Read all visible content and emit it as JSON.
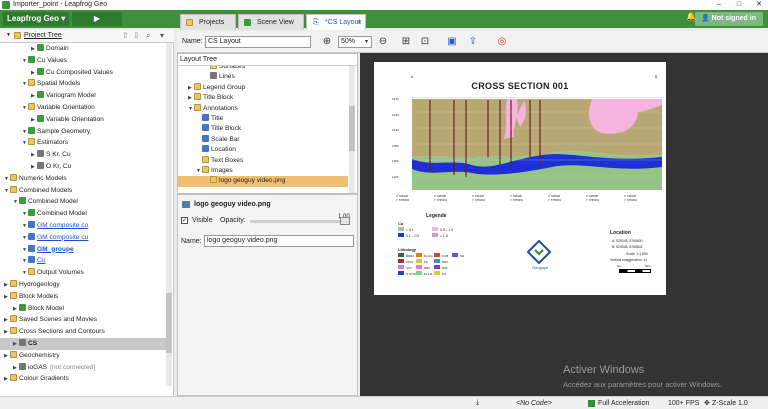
{
  "window": {
    "title": "Importer_point - Leapfrog Geo",
    "minimize": "–",
    "maximize": "□",
    "close": "✕"
  },
  "topbar": {
    "app_button": "Leapfrog Geo ▾",
    "play": "▶",
    "sign_in": "Not signed in",
    "bell_icon": "bell-icon"
  },
  "left_panel": {
    "title": "Project Tree",
    "rows": [
      {
        "label": "Domain",
        "indent": 3
      },
      {
        "label": "Cu Values",
        "indent": 2
      },
      {
        "label": "Cu Composited Values",
        "indent": 3
      },
      {
        "label": "Spatial Models",
        "indent": 2
      },
      {
        "label": "Variogram Model",
        "indent": 3
      },
      {
        "label": "Variable Orientation",
        "indent": 2
      },
      {
        "label": "Variable Orientation",
        "indent": 3
      },
      {
        "label": "Sample Geometry",
        "indent": 2
      },
      {
        "label": "Estimators",
        "indent": 2
      },
      {
        "label": "S Kr, Cu",
        "indent": 3
      },
      {
        "label": "O Kr, Cu",
        "indent": 3
      },
      {
        "label": "Numeric Models",
        "indent": 0
      },
      {
        "label": "Combined Models",
        "indent": 0
      },
      {
        "label": "Combined Model",
        "indent": 1
      },
      {
        "label": "Combined Model",
        "indent": 2
      },
      {
        "label": "GM composite co",
        "indent": 2
      },
      {
        "label": "GM composite cu",
        "indent": 2
      },
      {
        "label": "GM_groupe",
        "indent": 2
      },
      {
        "label": "Cu",
        "indent": 2
      },
      {
        "label": "Output Volumes",
        "indent": 2
      },
      {
        "label": "Hydrogeology",
        "indent": 0
      },
      {
        "label": "Block Models",
        "indent": 0
      },
      {
        "label": "Block Model",
        "indent": 1
      },
      {
        "label": "Saved Scenes and Movies",
        "indent": 0
      },
      {
        "label": "Cross Sections and Contours",
        "indent": 0
      },
      {
        "label": "CS",
        "indent": 1
      },
      {
        "label": "Geochemistry",
        "indent": 0
      },
      {
        "label": "ioGAS",
        "note": "[not connected]",
        "indent": 1
      },
      {
        "label": "Colour Gradients",
        "indent": 0
      }
    ]
  },
  "tabs": [
    {
      "label": "Projects"
    },
    {
      "label": "Scene View"
    },
    {
      "label": "*CS Layout"
    }
  ],
  "toolbar": {
    "name_label": "Name:",
    "name_value": "CS Layout",
    "zoom": "50%"
  },
  "layout_tree": {
    "title": "Layout Tree",
    "rows": [
      {
        "label": "Surfaces",
        "indent": 3
      },
      {
        "label": "Lines",
        "indent": 3
      },
      {
        "label": "Legend Group",
        "indent": 1
      },
      {
        "label": "Title Block",
        "indent": 1
      },
      {
        "label": "Annotations",
        "indent": 1
      },
      {
        "label": "Title",
        "indent": 2
      },
      {
        "label": "Title Block",
        "indent": 2
      },
      {
        "label": "Scale Bar",
        "indent": 2
      },
      {
        "label": "Location",
        "indent": 2
      },
      {
        "label": "Text Boxes",
        "indent": 2
      },
      {
        "label": "Images",
        "indent": 2
      },
      {
        "label": "logo geoguy video.png",
        "indent": 3
      }
    ]
  },
  "properties": {
    "title": "logo geoguy video.png",
    "visible_label": "Visible",
    "opacity_label": "Opacity:",
    "opacity_value": "1,00",
    "name_label": "Name:",
    "name_value": "logo geoguy video.png"
  },
  "section": {
    "title": "CROSS SECTION 001",
    "a": "A",
    "b": "B",
    "y_ticks": [
      "1270",
      "1240",
      "1210",
      "1180",
      "1150",
      "1120"
    ],
    "coords": [
      [
        "X: 525348",
        "Y: 8765600"
      ],
      [
        "X: 525398",
        "Y: 8765601"
      ],
      [
        "X: 525448",
        "Y: 8765601"
      ],
      [
        "X: 525498",
        "Y: 8765601"
      ],
      [
        "X: 525548",
        "Y: 8765601"
      ],
      [
        "X: 525598",
        "Y: 8765601"
      ],
      [
        "X: 525648",
        "Y: 8765601"
      ]
    ],
    "legend_title": "Legende",
    "cu_title": "Cu",
    "cu_items": [
      "< 0.1",
      "0.5 – 1.5",
      "0.1 – 0.5",
      "> 1.5"
    ],
    "litho_title": "Lithology",
    "litho_items": [
      "BDR2",
      "Dyoria",
      "CVB",
      "SD",
      "CMN",
      "FZ",
      "RSC",
      "",
      "CVT",
      "HBX",
      "RSF",
      "",
      "D STRAT",
      "M & R",
      "Kst",
      ""
    ],
    "logo_text": "Geoguys",
    "location_title": "Location",
    "loc_a": "A:    525348, 8765600",
    "loc_b": "B:    524948, 8765602",
    "scale": "Scale: 1:1 890",
    "vexag": "Vertical exaggeration: 1x",
    "scale_ticks": [
      "0m",
      "50m"
    ]
  },
  "status": {
    "code": "<No Code>",
    "accel": "Full Acceleration",
    "fps": "100+ FPS",
    "zscale": "Z-Scale 1.0"
  },
  "watermark": {
    "line1": "Activer Windows",
    "line2": "Accédez aux paramètres pour activer Windows."
  }
}
